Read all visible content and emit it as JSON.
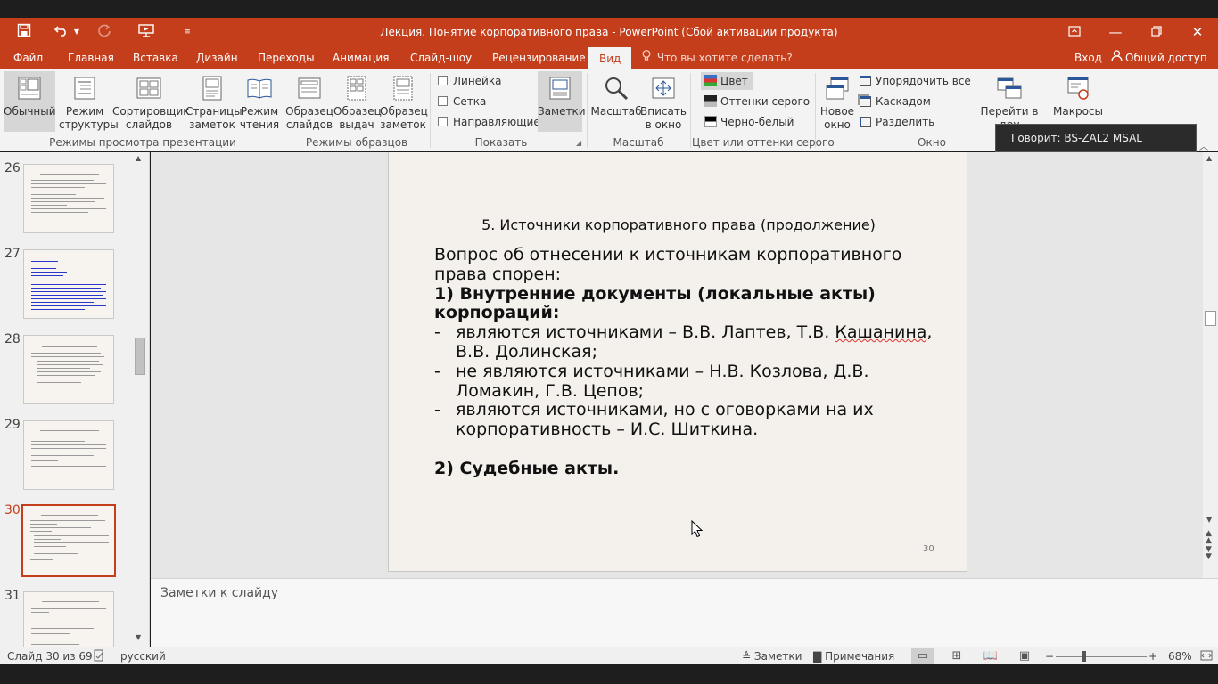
{
  "app": {
    "window_title": "Лекция. Понятие корпоративного права - PowerPoint (Сбой активации продукта)",
    "accent_color": "#c43e1c"
  },
  "quick_access": {
    "save_icon": "save-icon",
    "undo_icon": "undo-icon",
    "redo_icon": "redo-icon",
    "present_icon": "present-from-start-icon",
    "customize_icon": "customize-qat-icon"
  },
  "tabs": [
    {
      "label": "Файл"
    },
    {
      "label": "Главная"
    },
    {
      "label": "Вставка"
    },
    {
      "label": "Дизайн"
    },
    {
      "label": "Переходы"
    },
    {
      "label": "Анимация"
    },
    {
      "label": "Слайд-шоу"
    },
    {
      "label": "Рецензирование"
    },
    {
      "label": "Вид"
    }
  ],
  "tell_me": "Что вы хотите сделать?",
  "signin": "Вход",
  "share": "Общий доступ",
  "ribbon": {
    "group_views": {
      "label": "Режимы просмотра презентации",
      "normal": "Обычный",
      "outline_1": "Режим",
      "outline_2": "структуры",
      "sorter_1": "Сортировщик",
      "sorter_2": "слайдов",
      "notes_page_1": "Страницы",
      "notes_page_2": "заметок",
      "reading_1": "Режим",
      "reading_2": "чтения"
    },
    "group_masters": {
      "label": "Режимы образцов",
      "slide_master_1": "Образец",
      "slide_master_2": "слайдов",
      "handout_master_1": "Образец",
      "handout_master_2": "выдач",
      "notes_master_1": "Образец",
      "notes_master_2": "заметок"
    },
    "group_show": {
      "label": "Показать",
      "ruler": "Линейка",
      "grid": "Сетка",
      "guides": "Направляющие",
      "notes": "Заметки"
    },
    "group_zoom": {
      "label": "Масштаб",
      "zoom": "Масштаб",
      "fit_1": "Вписать",
      "fit_2": "в окно"
    },
    "group_color": {
      "label": "Цвет или оттенки серого",
      "color": "Цвет",
      "grayscale": "Оттенки серого",
      "bw": "Черно-белый"
    },
    "group_window": {
      "label": "Окно",
      "new_window_1": "Новое",
      "new_window_2": "окно",
      "arrange_all": "Упорядочить все",
      "cascade": "Каскадом",
      "split": "Разделить",
      "switch_1": "Перейти в",
      "switch_2": "дру"
    },
    "group_macros": {
      "macros": "Макросы"
    }
  },
  "tooltip": "Говорит: BS-ZAL2 MSAL",
  "thumbnails": [
    {
      "number": "26"
    },
    {
      "number": "27"
    },
    {
      "number": "28"
    },
    {
      "number": "29"
    },
    {
      "number": "30"
    },
    {
      "number": "31"
    }
  ],
  "slide": {
    "title": "5. Источники корпоративного права (продолжение)",
    "intro_1": "Вопрос об отнесении к источникам корпоративного",
    "intro_2": "права спорен:",
    "point1_1": "1) Внутренние документы (локальные акты)",
    "point1_2": "корпораций:",
    "dash": "-",
    "bullet1_1": "являются источниками – В.В. Лаптев, Т.В. ",
    "bullet1_sq": "Кашанина",
    "bullet1_1b": ",",
    "bullet1_2": "В.В. Долинская;",
    "bullet2_1": "не являются источниками – Н.В. Козлова, Д.В.",
    "bullet2_2": "Ломакин, Г.В. Цепов;",
    "bullet3_1": "являются источниками, но с оговорками на их",
    "bullet3_2": "корпоративность – И.С. Шиткина.",
    "point2": "2) Судебные акты.",
    "number": "30"
  },
  "notes_placeholder": "Заметки к слайду",
  "status": {
    "slide_of": "Слайд 30 из 69",
    "language": "русский",
    "notes": "Заметки",
    "comments": "Примечания",
    "zoom_percent": "68%",
    "zoom_level": 0.68
  }
}
